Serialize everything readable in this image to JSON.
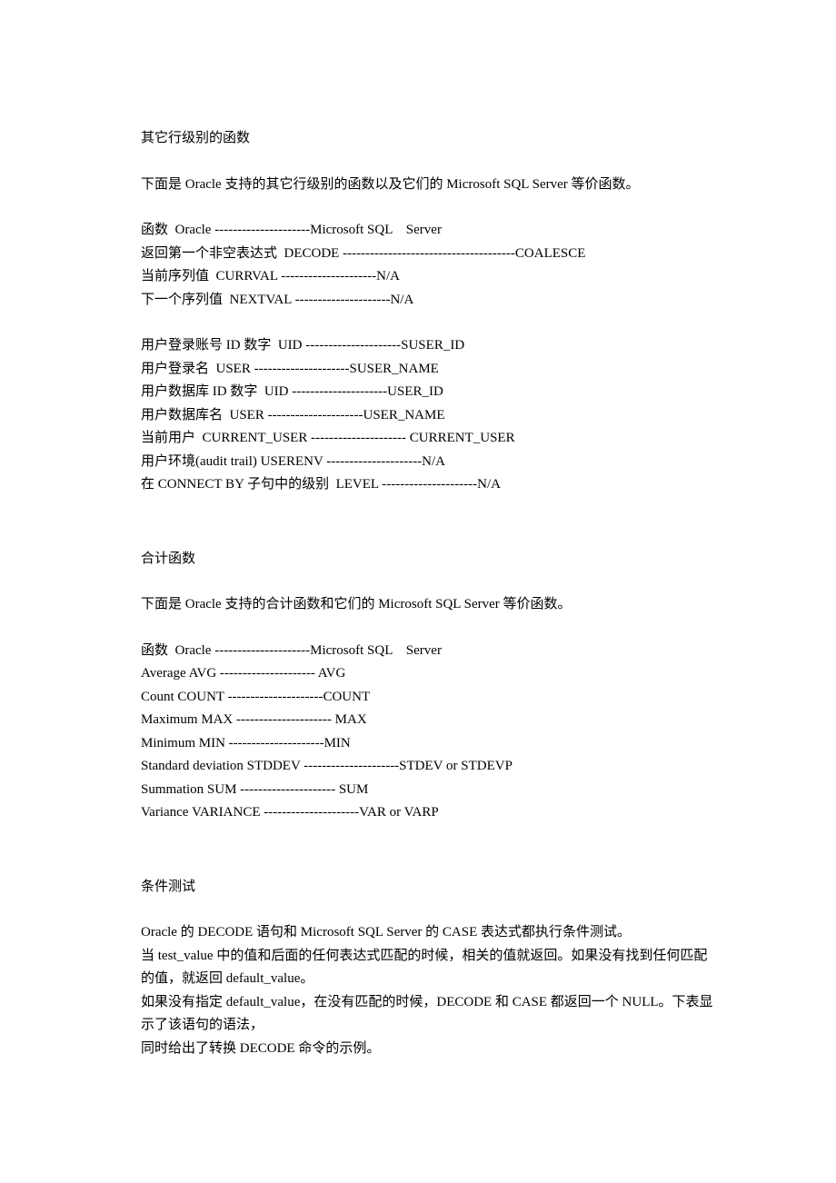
{
  "section1": {
    "title": "其它行级别的函数",
    "intro": "下面是 Oracle 支持的其它行级别的函数以及它们的 Microsoft SQL Server 等价函数。",
    "header": "函数  Oracle ---------------------Microsoft SQL    Server",
    "rows1": [
      "返回第一个非空表达式  DECODE --------------------------------------COALESCE",
      "当前序列值  CURRVAL ---------------------N/A",
      "下一个序列值  NEXTVAL ---------------------N/A"
    ],
    "rows2": [
      "用户登录账号 ID 数字  UID ---------------------SUSER_ID",
      "用户登录名  USER ---------------------SUSER_NAME",
      "用户数据库 ID 数字  UID ---------------------USER_ID",
      "用户数据库名  USER ---------------------USER_NAME",
      "当前用户  CURRENT_USER --------------------- CURRENT_USER",
      "用户环境(audit trail) USERENV ---------------------N/A",
      "在 CONNECT BY 子句中的级别  LEVEL ---------------------N/A"
    ]
  },
  "section2": {
    "title": "合计函数",
    "intro": "下面是 Oracle 支持的合计函数和它们的 Microsoft SQL Server 等价函数。",
    "header": "函数  Oracle ---------------------Microsoft SQL    Server",
    "rows": [
      "Average AVG --------------------- AVG",
      "Count COUNT ---------------------COUNT",
      "Maximum MAX --------------------- MAX",
      "Minimum MIN ---------------------MIN",
      "Standard deviation STDDEV ---------------------STDEV or STDEVP",
      "Summation SUM --------------------- SUM",
      "Variance VARIANCE ---------------------VAR or VARP"
    ]
  },
  "section3": {
    "title": "条件测试",
    "lines": [
      "Oracle 的 DECODE 语句和 Microsoft SQL Server 的 CASE 表达式都执行条件测试。",
      "当 test_value 中的值和后面的任何表达式匹配的时候，相关的值就返回。如果没有找到任何匹配的值，就返回 default_value。",
      "如果没有指定 default_value，在没有匹配的时候，DECODE 和 CASE 都返回一个 NULL。下表显示了该语句的语法，",
      "同时给出了转换 DECODE 命令的示例。"
    ]
  }
}
